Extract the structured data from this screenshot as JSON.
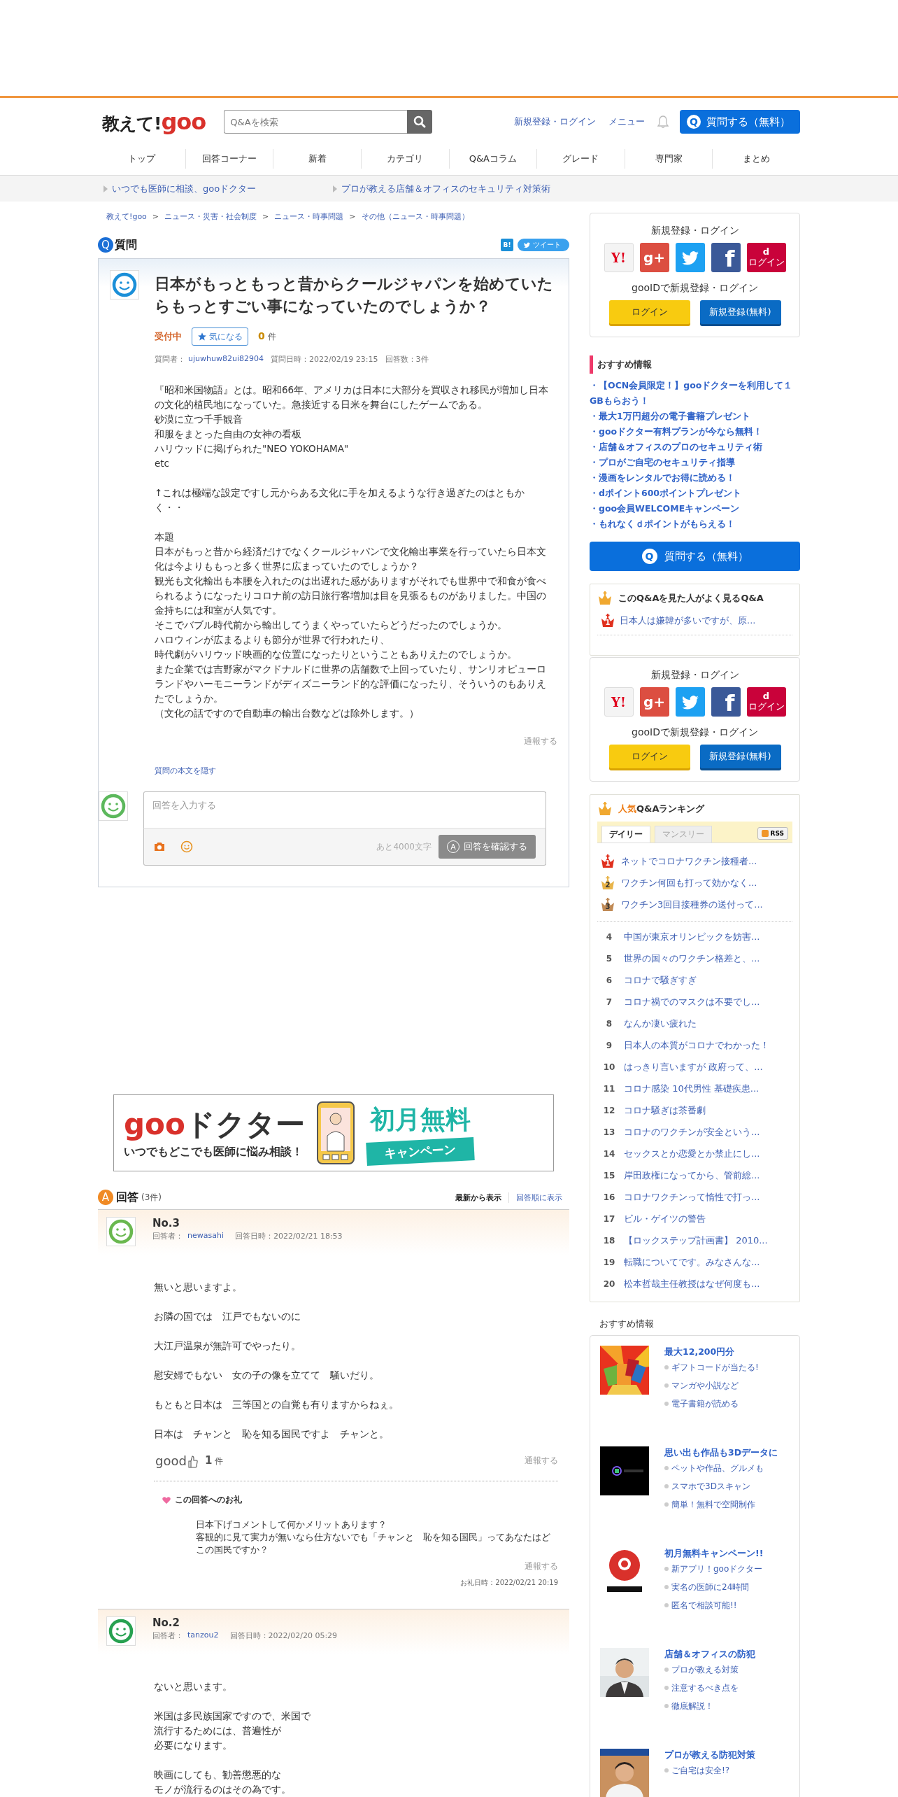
{
  "header": {
    "logo_text": "教えて!",
    "logo_brand": "goo",
    "search": {
      "placeholder": "Q&Aを検索"
    },
    "links": [
      "新規登録・ログイン",
      "メニュー"
    ],
    "ask_icon": "Q",
    "ask_button": "質問する（無料）"
  },
  "nav": [
    "トップ",
    "回答コーナー",
    "新着",
    "カテゴリ",
    "Q&Aコラム",
    "グレード",
    "専門家",
    "まとめ"
  ],
  "promos": [
    "いつでも医師に相談、gooドクター",
    "プロが教える店舗＆オフィスのセキュリティ対策術"
  ],
  "breadcrumb": {
    "separator": ">",
    "items": [
      "教えて!goo",
      "ニュース・災害・社会制度",
      "ニュース・時事問題",
      "その他（ニュース・時事問題）"
    ]
  },
  "question": {
    "badge": "Q",
    "heading": "質問",
    "share": {
      "hatena": "B!",
      "tweet": "ツイート"
    },
    "title": "日本がもっともっと昔からクールジャパンを始めていたらもっとすごい事になっていたのでしょうか？",
    "status": "受付中",
    "watch": "気になる",
    "watch_count": "**0** 件",
    "asker_label": "質問者：",
    "asker": "ujuwhuw82ui82904",
    "date": "質問日時：2022/02/19 23:15",
    "answers_count": "回答数：3件",
    "body": [
      [
        "『昭和米国物語』とは。昭和66年、アメリカは日本に大部分を買収され移民が増加し日本の文化的植民地になっていた。急接近する日米を舞台にしたゲームである。",
        "砂漠に立つ千手観音",
        "和服をまとった自由の女神の看板",
        "ハリウッドに掲げられた\"NEO YOKOHAMA\"",
        "etc"
      ],
      [
        "↑これは極端な設定ですし元からある文化に手を加えるような行き過ぎたのはともかく・・"
      ],
      [
        "本題",
        "日本がもっと昔から経済だけでなくクールジャパンで文化輸出事業を行っていたら日本文化は今よりももっと多く世界に広まっていたのでしょうか？",
        "観光も文化輸出も本腰を入れたのは出遅れた感がありますがそれでも世界中で和食が食べられるようになったりコロナ前の訪日旅行客増加は目を見張るものがありました。中国の金持ちには和室が人気です。",
        "そこでバブル時代前から輸出してうまくやっていたらどうだったのでしょうか。",
        "ハロウィンが広まるよりも節分が世界で行われたり、",
        "時代劇がハリウッド映画的な位置になったりということもありえたのでしょうか。",
        "また企業では吉野家がマクドナルドに世界の店舗数で上回っていたり、サンリオピューロランドやハーモニーランドがディズニーランド的な評価になったり、そういうのもありえたでしょうか。",
        "（文化の話ですので自動車の輸出台数などは除外します。）"
      ]
    ],
    "report": "通報する",
    "hide_link": "質問の本文を隠す",
    "answer_form": {
      "placeholder": "回答を入力する",
      "remaining": "あと4000文字",
      "submit_icon": "A",
      "submit": "回答を確認する",
      "disabled": true
    }
  },
  "banner": {
    "brand": "goo",
    "title": "ドクター",
    "tagline": "いつでもどこでも医師に悩み相談！",
    "offer": "初月無料",
    "ribbon": "キャンペーン"
  },
  "answers_section": {
    "badge": "A",
    "heading": "回答",
    "count": "(3件)",
    "sort": [
      {
        "label": "最新から表示",
        "selected": true
      },
      {
        "label": "回答順に表示",
        "selected": false
      }
    ]
  },
  "answers": [
    {
      "number": "No.3",
      "answerer_label": "回答者：",
      "answerer": "newasahi",
      "date": "回答日時：2022/02/21 18:53",
      "color": "#6ab84f",
      "body": [
        [
          "無いと思いますよ。"
        ],
        [
          "お隣の国では　江戸でもないのに"
        ],
        [
          "大江戸温泉が無許可でやったり。"
        ],
        [
          "慰安婦でもない　女の子の像を立てて　騒いだり。"
        ],
        [
          "もともと日本は　三等国との自覚も有りますからねぇ。"
        ],
        [
          "日本は　チャンと　恥を知る国民ですよ　チャンと。"
        ]
      ],
      "good": "good",
      "good_count": "**1** 件",
      "report": "通報する",
      "thanks": {
        "title": "この回答へのお礼",
        "lines": [
          "日本下げコメントして何かメリットあります？",
          "客観的に見て実力が無いなら仕方ないでも「チャンと　恥を知る国民」ってあなたはどこの国民ですか？"
        ],
        "report": "通報する",
        "date": "お礼日時：2022/02/21 20:19"
      }
    },
    {
      "number": "No.2",
      "answerer_label": "回答者：",
      "answerer": "tanzou2",
      "date": "回答日時：2022/02/20 05:29",
      "color": "#27a150",
      "body": [
        [
          "ないと思います。"
        ],
        [
          "米国は多民族国家ですので、米国で",
          "流行するためには、普遍性が",
          "必要になります。"
        ],
        [
          "映画にしても、勧善懲悪的な",
          "モノが流行るのはその為です。"
        ]
      ]
    }
  ],
  "login_boxes": [
    {
      "title": "新規登録・ログイン",
      "socials": [
        {
          "kind": "yahoo",
          "label": "Y!"
        },
        {
          "kind": "google",
          "label": "g+"
        },
        {
          "kind": "twitter"
        },
        {
          "kind": "facebook",
          "label": "f"
        },
        {
          "kind": "docomo",
          "label": "d",
          "sub": "ログイン"
        }
      ],
      "goo_label": "gooIDで新規登録・ログイン",
      "buttons": [
        {
          "kind": "login",
          "label": "ログイン"
        },
        {
          "kind": "register",
          "label": "新規登録(無料)"
        }
      ]
    },
    {
      "title": "新規登録・ログイン",
      "socials": [
        {
          "kind": "yahoo",
          "label": "Y!"
        },
        {
          "kind": "google",
          "label": "g+"
        },
        {
          "kind": "twitter"
        },
        {
          "kind": "facebook",
          "label": "f"
        },
        {
          "kind": "docomo",
          "label": "d",
          "sub": "ログイン"
        }
      ],
      "goo_label": "gooIDで新規登録・ログイン",
      "buttons": [
        {
          "kind": "login",
          "label": "ログイン"
        },
        {
          "kind": "register",
          "label": "新規登録(無料)"
        }
      ]
    }
  ],
  "recommend": {
    "title": "おすすめ情報",
    "bullet": "・",
    "items": [
      "【OCN会員限定！】gooドクターを利用して１GBもらおう！",
      "最大1万円超分の電子書籍プレゼント",
      "gooドクター有料プランが今なら無料！",
      "店舗＆オフィスのプロのセキュリティ術",
      "プロがご自宅のセキュリティ指導",
      "漫画をレンタルでお得に読める！",
      "dポイント600ポイントプレゼント",
      "goo会員WELCOMEキャンペーン",
      "もれなくｄポイントがもらえる！"
    ]
  },
  "side_ask": {
    "icon": "Q",
    "label": "質問する（無料）"
  },
  "related": {
    "title": "このQ&Aを見た人がよく見るQ&A",
    "items": [
      {
        "rank": "1",
        "color": "#e0301e",
        "text": "日本人は嫌韓が多いですが、原..."
      }
    ]
  },
  "ranking": {
    "title_accent": "人気",
    "title": "Q&Aランキング",
    "tabs": [
      {
        "label": "デイリー",
        "selected": true
      },
      {
        "label": "マンスリー",
        "selected": false
      }
    ],
    "rss": "RSS",
    "items": [
      {
        "kind": "crown",
        "rank": "1",
        "color": "#e0301e",
        "text": "ネットでコロナワクチン接種者..."
      },
      {
        "kind": "crown",
        "rank": "2",
        "color": "#e8b44a",
        "text": "ワクチン何回も打って効かなく..."
      },
      {
        "kind": "crown",
        "rank": "3",
        "color": "#c08a55",
        "text": "ワクチン3回目接種券の送付って..."
      },
      {
        "kind": "number",
        "rank": "4",
        "text": "中国が東京オリンピックを妨害..."
      },
      {
        "kind": "number",
        "rank": "5",
        "text": "世界の国々のワクチン格差と、..."
      },
      {
        "kind": "number",
        "rank": "6",
        "text": "コロナで騒ぎすぎ"
      },
      {
        "kind": "number",
        "rank": "7",
        "text": "コロナ禍でのマスクは不要でし..."
      },
      {
        "kind": "number",
        "rank": "8",
        "text": "なんか凄い疲れた"
      },
      {
        "kind": "number",
        "rank": "9",
        "text": "日本人の本質がコロナでわかった！"
      },
      {
        "kind": "number",
        "rank": "10",
        "text": "はっきり言いますが 政府って、..."
      },
      {
        "kind": "number",
        "rank": "11",
        "text": "コロナ感染 10代男性 基礎疾患..."
      },
      {
        "kind": "number",
        "rank": "12",
        "text": "コロナ騒ぎは茶番劇"
      },
      {
        "kind": "number",
        "rank": "13",
        "text": "コロナのワクチンが安全という..."
      },
      {
        "kind": "number",
        "rank": "14",
        "text": "セックスとか恋愛とか禁止にし..."
      },
      {
        "kind": "number",
        "rank": "15",
        "text": "岸田政権になってから、管前総..."
      },
      {
        "kind": "number",
        "rank": "16",
        "text": "コロナワクチンって惰性で打っ..."
      },
      {
        "kind": "number",
        "rank": "17",
        "text": "ビル・ゲイツの警告"
      },
      {
        "kind": "number",
        "rank": "18",
        "text": "【ロックステップ計画書】 2010..."
      },
      {
        "kind": "number",
        "rank": "19",
        "text": "転職についてです。みなさんな..."
      },
      {
        "kind": "number",
        "rank": "20",
        "text": "松本哲哉主任教授はなぜ何度も..."
      }
    ]
  },
  "ads": {
    "title": "おすすめ情報",
    "items": [
      {
        "title": "最大12,200円分",
        "lines": [
          "ギフトコードが当たる!",
          "マンガや小説など",
          "電子書籍が読める"
        ]
      },
      {
        "title": "思い出も作品も3Dデータに",
        "lines": [
          "ペットや作品、グルメも",
          "スマホで3Dスキャン",
          "簡単！無料で空間制作"
        ]
      },
      {
        "title": "初月無料キャンペーン!!",
        "lines": [
          "新アプリ！gooドクター",
          "実名の医師に24時間",
          "匿名で相談可能!!"
        ]
      },
      {
        "title": "店舗＆オフィスの防犯",
        "lines": [
          "プロが教える対策",
          "注意するべき点を",
          "徹底解説！"
        ]
      },
      {
        "title": "プロが教える防犯対策",
        "lines": [
          "ご自宅は安全!?"
        ]
      }
    ]
  }
}
